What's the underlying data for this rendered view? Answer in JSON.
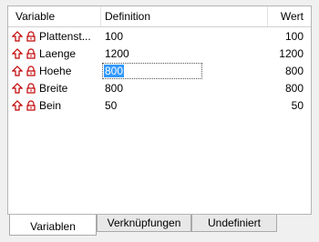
{
  "table": {
    "headers": {
      "variable": "Variable",
      "definition": "Definition",
      "wert": "Wert"
    },
    "rows": [
      {
        "variable": "Plattenst...",
        "definition": "100",
        "wert": "100"
      },
      {
        "variable": "Laenge",
        "definition": "1200",
        "wert": "1200"
      },
      {
        "variable": "Hoehe",
        "definition": "800",
        "wert": "800"
      },
      {
        "variable": "Breite",
        "definition": "800",
        "wert": "800"
      },
      {
        "variable": "Bein",
        "definition": "50",
        "wert": "50"
      }
    ]
  },
  "tabs": [
    {
      "label": "Variablen"
    },
    {
      "label": "Verknüpfungen"
    },
    {
      "label": "Undefiniert"
    }
  ],
  "colors": {
    "icon_red": "#c00000",
    "selection": "#3399ff"
  },
  "icons": {
    "row_icon_1": "up-arrow-icon",
    "row_icon_2": "lock-icon"
  }
}
